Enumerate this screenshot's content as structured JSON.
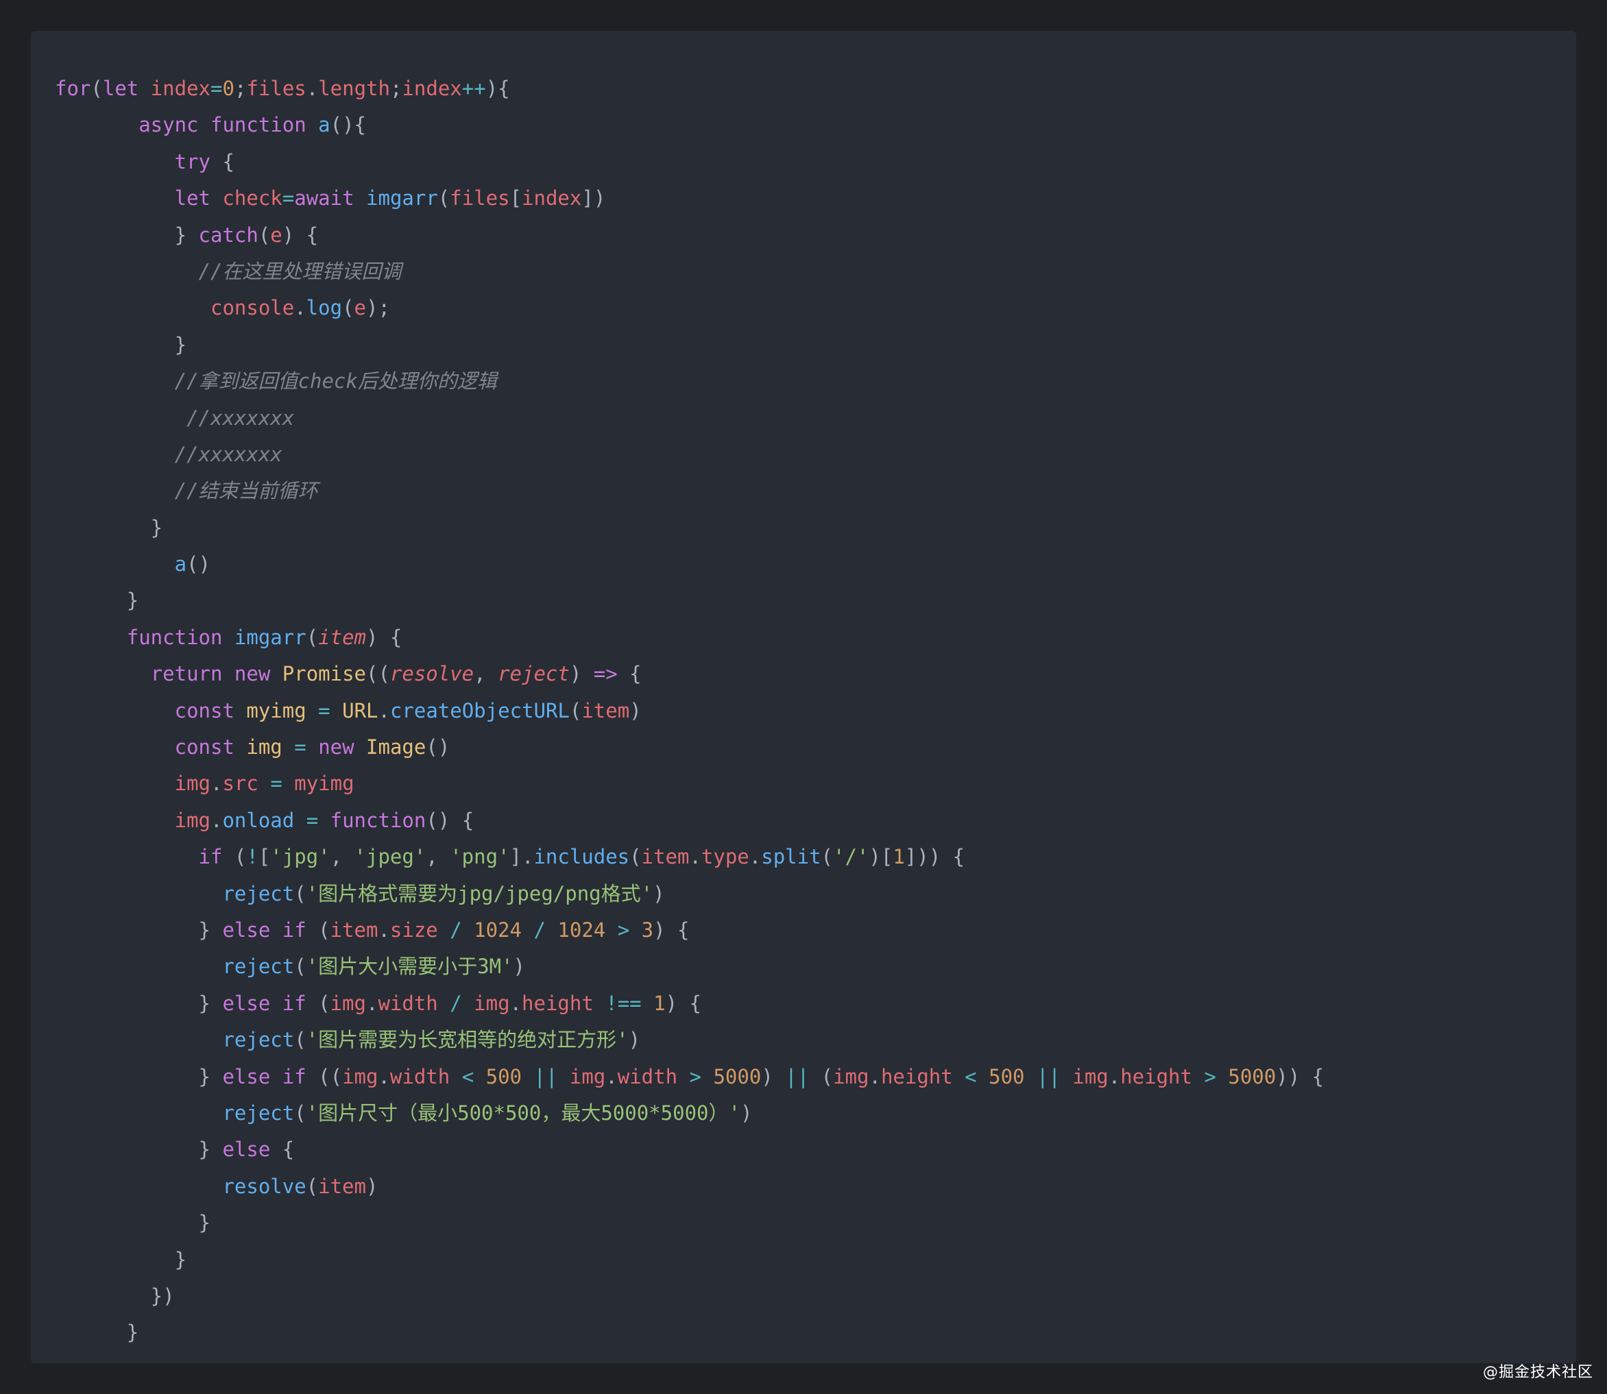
{
  "colors": {
    "background": "#1e2024",
    "panel": "#282c34",
    "keyword": "#c678dd",
    "variable": "#e06c75",
    "function": "#61afef",
    "number": "#d19a66",
    "string": "#98c379",
    "operator": "#56b6c2",
    "punctuation": "#abb2bf",
    "class": "#e5c07b",
    "comment": "#7f848e"
  },
  "watermark": "@掘金技术社区",
  "code_lines": [
    [
      [
        "kw",
        "for"
      ],
      [
        "pn",
        "("
      ],
      [
        "kw",
        "let"
      ],
      [
        "pn",
        " "
      ],
      [
        "vr",
        "index"
      ],
      [
        "op",
        "="
      ],
      [
        "nm",
        "0"
      ],
      [
        "pn",
        ";"
      ],
      [
        "vr",
        "files"
      ],
      [
        "pn",
        "."
      ],
      [
        "vr",
        "length"
      ],
      [
        "pn",
        ";"
      ],
      [
        "vr",
        "index"
      ],
      [
        "op",
        "++"
      ],
      [
        "pn",
        "){"
      ]
    ],
    [
      [
        "pn",
        "       "
      ],
      [
        "kw",
        "async"
      ],
      [
        "pn",
        " "
      ],
      [
        "kw",
        "function"
      ],
      [
        "pn",
        " "
      ],
      [
        "fn",
        "a"
      ],
      [
        "pn",
        "(){"
      ]
    ],
    [
      [
        "pn",
        "          "
      ],
      [
        "kw",
        "try"
      ],
      [
        "pn",
        " {"
      ]
    ],
    [
      [
        "pn",
        "          "
      ],
      [
        "kw",
        "let"
      ],
      [
        "pn",
        " "
      ],
      [
        "vr",
        "check"
      ],
      [
        "op",
        "="
      ],
      [
        "kw",
        "await"
      ],
      [
        "pn",
        " "
      ],
      [
        "fn",
        "imgarr"
      ],
      [
        "pn",
        "("
      ],
      [
        "vr",
        "files"
      ],
      [
        "pn",
        "["
      ],
      [
        "vr",
        "index"
      ],
      [
        "pn",
        "])"
      ]
    ],
    [
      [
        "pn",
        "          } "
      ],
      [
        "kw",
        "catch"
      ],
      [
        "pn",
        "("
      ],
      [
        "vr",
        "e"
      ],
      [
        "pn",
        ") {"
      ]
    ],
    [
      [
        "pn",
        "            "
      ],
      [
        "cm",
        "//在这里处理错误回调"
      ]
    ],
    [
      [
        "pn",
        "             "
      ],
      [
        "vr",
        "console"
      ],
      [
        "pn",
        "."
      ],
      [
        "fn",
        "log"
      ],
      [
        "pn",
        "("
      ],
      [
        "vr",
        "e"
      ],
      [
        "pn",
        ");"
      ]
    ],
    [
      [
        "pn",
        "          }"
      ]
    ],
    [
      [
        "pn",
        "          "
      ],
      [
        "cm",
        "//拿到返回值check后处理你的逻辑"
      ]
    ],
    [
      [
        "pn",
        "           "
      ],
      [
        "cm",
        "//xxxxxxx"
      ]
    ],
    [
      [
        "pn",
        "          "
      ],
      [
        "cm",
        "//xxxxxxx"
      ]
    ],
    [
      [
        "pn",
        "          "
      ],
      [
        "cm",
        "//结束当前循环"
      ]
    ],
    [
      [
        "pn",
        "        }"
      ]
    ],
    [
      [
        "pn",
        "          "
      ],
      [
        "fn",
        "a"
      ],
      [
        "pn",
        "()"
      ]
    ],
    [
      [
        "pn",
        "      }"
      ]
    ],
    [
      [
        "pn",
        "      "
      ],
      [
        "kw",
        "function"
      ],
      [
        "pn",
        " "
      ],
      [
        "fn",
        "imgarr"
      ],
      [
        "pn",
        "("
      ],
      [
        "pa",
        "item"
      ],
      [
        "pn",
        ") {"
      ]
    ],
    [
      [
        "pn",
        "        "
      ],
      [
        "kw",
        "return"
      ],
      [
        "pn",
        " "
      ],
      [
        "kw",
        "new"
      ],
      [
        "pn",
        " "
      ],
      [
        "cl",
        "Promise"
      ],
      [
        "pn",
        "(("
      ],
      [
        "pa",
        "resolve"
      ],
      [
        "pn",
        ", "
      ],
      [
        "pa",
        "reject"
      ],
      [
        "pn",
        ") "
      ],
      [
        "kw",
        "=>"
      ],
      [
        "pn",
        " {"
      ]
    ],
    [
      [
        "pn",
        "          "
      ],
      [
        "kw",
        "const"
      ],
      [
        "pn",
        " "
      ],
      [
        "cl",
        "myimg"
      ],
      [
        "pn",
        " "
      ],
      [
        "op",
        "="
      ],
      [
        "pn",
        " "
      ],
      [
        "cl",
        "URL"
      ],
      [
        "pn",
        "."
      ],
      [
        "fn",
        "createObjectURL"
      ],
      [
        "pn",
        "("
      ],
      [
        "vr",
        "item"
      ],
      [
        "pn",
        ")"
      ]
    ],
    [
      [
        "pn",
        "          "
      ],
      [
        "kw",
        "const"
      ],
      [
        "pn",
        " "
      ],
      [
        "cl",
        "img"
      ],
      [
        "pn",
        " "
      ],
      [
        "op",
        "="
      ],
      [
        "pn",
        " "
      ],
      [
        "kw",
        "new"
      ],
      [
        "pn",
        " "
      ],
      [
        "cl",
        "Image"
      ],
      [
        "pn",
        "()"
      ]
    ],
    [
      [
        "pn",
        "          "
      ],
      [
        "vr",
        "img"
      ],
      [
        "pn",
        "."
      ],
      [
        "vr",
        "src"
      ],
      [
        "pn",
        " "
      ],
      [
        "op",
        "="
      ],
      [
        "pn",
        " "
      ],
      [
        "vr",
        "myimg"
      ]
    ],
    [
      [
        "pn",
        "          "
      ],
      [
        "vr",
        "img"
      ],
      [
        "pn",
        "."
      ],
      [
        "fn",
        "onload"
      ],
      [
        "pn",
        " "
      ],
      [
        "op",
        "="
      ],
      [
        "pn",
        " "
      ],
      [
        "kw",
        "function"
      ],
      [
        "pn",
        "() {"
      ]
    ],
    [
      [
        "pn",
        "            "
      ],
      [
        "kw",
        "if"
      ],
      [
        "pn",
        " ("
      ],
      [
        "op",
        "!"
      ],
      [
        "pn",
        "["
      ],
      [
        "st",
        "'jpg'"
      ],
      [
        "pn",
        ", "
      ],
      [
        "st",
        "'jpeg'"
      ],
      [
        "pn",
        ", "
      ],
      [
        "st",
        "'png'"
      ],
      [
        "pn",
        "]."
      ],
      [
        "fn",
        "includes"
      ],
      [
        "pn",
        "("
      ],
      [
        "vr",
        "item"
      ],
      [
        "pn",
        "."
      ],
      [
        "vr",
        "type"
      ],
      [
        "pn",
        "."
      ],
      [
        "fn",
        "split"
      ],
      [
        "pn",
        "("
      ],
      [
        "st",
        "'/'"
      ],
      [
        "pn",
        ")["
      ],
      [
        "nm",
        "1"
      ],
      [
        "pn",
        "])) {"
      ]
    ],
    [
      [
        "pn",
        "              "
      ],
      [
        "fn",
        "reject"
      ],
      [
        "pn",
        "("
      ],
      [
        "st",
        "'图片格式需要为jpg/jpeg/png格式'"
      ],
      [
        "pn",
        ")"
      ]
    ],
    [
      [
        "pn",
        "            } "
      ],
      [
        "kw",
        "else"
      ],
      [
        "pn",
        " "
      ],
      [
        "kw",
        "if"
      ],
      [
        "pn",
        " ("
      ],
      [
        "vr",
        "item"
      ],
      [
        "pn",
        "."
      ],
      [
        "vr",
        "size"
      ],
      [
        "pn",
        " "
      ],
      [
        "op",
        "/"
      ],
      [
        "pn",
        " "
      ],
      [
        "nm",
        "1024"
      ],
      [
        "pn",
        " "
      ],
      [
        "op",
        "/"
      ],
      [
        "pn",
        " "
      ],
      [
        "nm",
        "1024"
      ],
      [
        "pn",
        " "
      ],
      [
        "op",
        ">"
      ],
      [
        "pn",
        " "
      ],
      [
        "nm",
        "3"
      ],
      [
        "pn",
        ") {"
      ]
    ],
    [
      [
        "pn",
        "              "
      ],
      [
        "fn",
        "reject"
      ],
      [
        "pn",
        "("
      ],
      [
        "st",
        "'图片大小需要小于3M'"
      ],
      [
        "pn",
        ")"
      ]
    ],
    [
      [
        "pn",
        "            } "
      ],
      [
        "kw",
        "else"
      ],
      [
        "pn",
        " "
      ],
      [
        "kw",
        "if"
      ],
      [
        "pn",
        " ("
      ],
      [
        "vr",
        "img"
      ],
      [
        "pn",
        "."
      ],
      [
        "vr",
        "width"
      ],
      [
        "pn",
        " "
      ],
      [
        "op",
        "/"
      ],
      [
        "pn",
        " "
      ],
      [
        "vr",
        "img"
      ],
      [
        "pn",
        "."
      ],
      [
        "vr",
        "height"
      ],
      [
        "pn",
        " "
      ],
      [
        "op",
        "!=="
      ],
      [
        "pn",
        " "
      ],
      [
        "nm",
        "1"
      ],
      [
        "pn",
        ") {"
      ]
    ],
    [
      [
        "pn",
        "              "
      ],
      [
        "fn",
        "reject"
      ],
      [
        "pn",
        "("
      ],
      [
        "st",
        "'图片需要为长宽相等的绝对正方形'"
      ],
      [
        "pn",
        ")"
      ]
    ],
    [
      [
        "pn",
        "            } "
      ],
      [
        "kw",
        "else"
      ],
      [
        "pn",
        " "
      ],
      [
        "kw",
        "if"
      ],
      [
        "pn",
        " (("
      ],
      [
        "vr",
        "img"
      ],
      [
        "pn",
        "."
      ],
      [
        "vr",
        "width"
      ],
      [
        "pn",
        " "
      ],
      [
        "op",
        "<"
      ],
      [
        "pn",
        " "
      ],
      [
        "nm",
        "500"
      ],
      [
        "pn",
        " "
      ],
      [
        "op",
        "||"
      ],
      [
        "pn",
        " "
      ],
      [
        "vr",
        "img"
      ],
      [
        "pn",
        "."
      ],
      [
        "vr",
        "width"
      ],
      [
        "pn",
        " "
      ],
      [
        "op",
        ">"
      ],
      [
        "pn",
        " "
      ],
      [
        "nm",
        "5000"
      ],
      [
        "pn",
        ") "
      ],
      [
        "op",
        "||"
      ],
      [
        "pn",
        " ("
      ],
      [
        "vr",
        "img"
      ],
      [
        "pn",
        "."
      ],
      [
        "vr",
        "height"
      ],
      [
        "pn",
        " "
      ],
      [
        "op",
        "<"
      ],
      [
        "pn",
        " "
      ],
      [
        "nm",
        "500"
      ],
      [
        "pn",
        " "
      ],
      [
        "op",
        "||"
      ],
      [
        "pn",
        " "
      ],
      [
        "vr",
        "img"
      ],
      [
        "pn",
        "."
      ],
      [
        "vr",
        "height"
      ],
      [
        "pn",
        " "
      ],
      [
        "op",
        ">"
      ],
      [
        "pn",
        " "
      ],
      [
        "nm",
        "5000"
      ],
      [
        "pn",
        ")) {"
      ]
    ],
    [
      [
        "pn",
        "              "
      ],
      [
        "fn",
        "reject"
      ],
      [
        "pn",
        "("
      ],
      [
        "st",
        "'图片尺寸（最小500*500，最大5000*5000）'"
      ],
      [
        "pn",
        ")"
      ]
    ],
    [
      [
        "pn",
        "            } "
      ],
      [
        "kw",
        "else"
      ],
      [
        "pn",
        " {"
      ]
    ],
    [
      [
        "pn",
        "              "
      ],
      [
        "fn",
        "resolve"
      ],
      [
        "pn",
        "("
      ],
      [
        "vr",
        "item"
      ],
      [
        "pn",
        ")"
      ]
    ],
    [
      [
        "pn",
        "            }"
      ]
    ],
    [
      [
        "pn",
        "          }"
      ]
    ],
    [
      [
        "pn",
        "        })"
      ]
    ],
    [
      [
        "pn",
        "      }"
      ]
    ]
  ]
}
